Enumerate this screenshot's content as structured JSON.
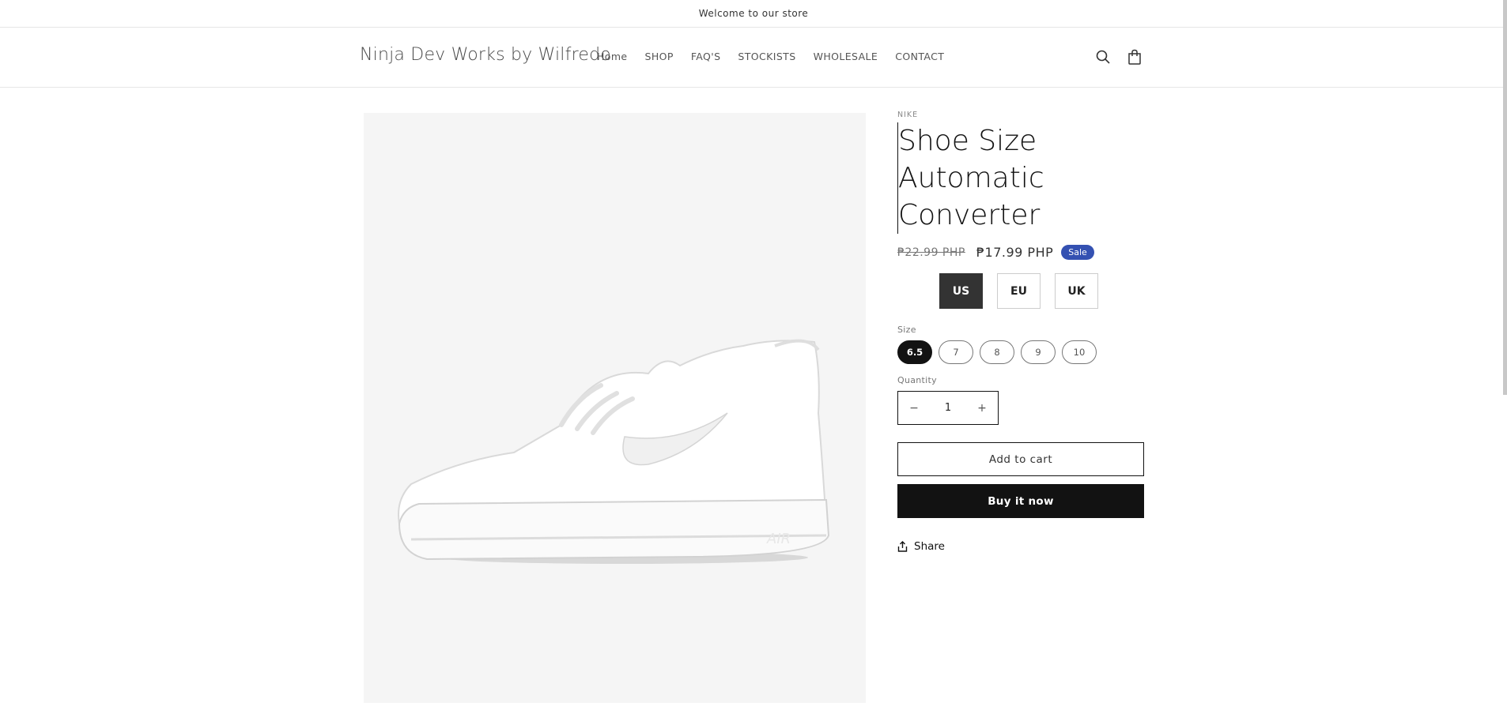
{
  "announcement": {
    "text": "Welcome to our store"
  },
  "header": {
    "logo": "Ninja Dev Works by Wilfredo",
    "nav": [
      "Home",
      "SHOP",
      "FAQ'S",
      "STOCKISTS",
      "WHOLESALE",
      "CONTACT"
    ],
    "icons": [
      "search-icon",
      "cart-icon"
    ]
  },
  "product": {
    "vendor": "NIKE",
    "title": "Shoe Size Automatic Converter",
    "price_old": "₱22.99 PHP",
    "price_new": "₱17.99 PHP",
    "badge": "Sale",
    "converter": {
      "options": [
        "US",
        "EU",
        "UK"
      ],
      "selected": "US"
    },
    "size_label": "Size",
    "sizes": [
      "6.5",
      "7",
      "8",
      "9",
      "10"
    ],
    "selected_size": "6.5",
    "quantity_label": "Quantity",
    "quantity": "1",
    "qty_minus": "−",
    "qty_plus": "+",
    "add_to_cart": "Add to cart",
    "buy_now": "Buy it now",
    "share": "Share"
  },
  "colors": {
    "accent_badge": "#3451b2",
    "primary": "#121212",
    "selected_converter": "#333333"
  }
}
